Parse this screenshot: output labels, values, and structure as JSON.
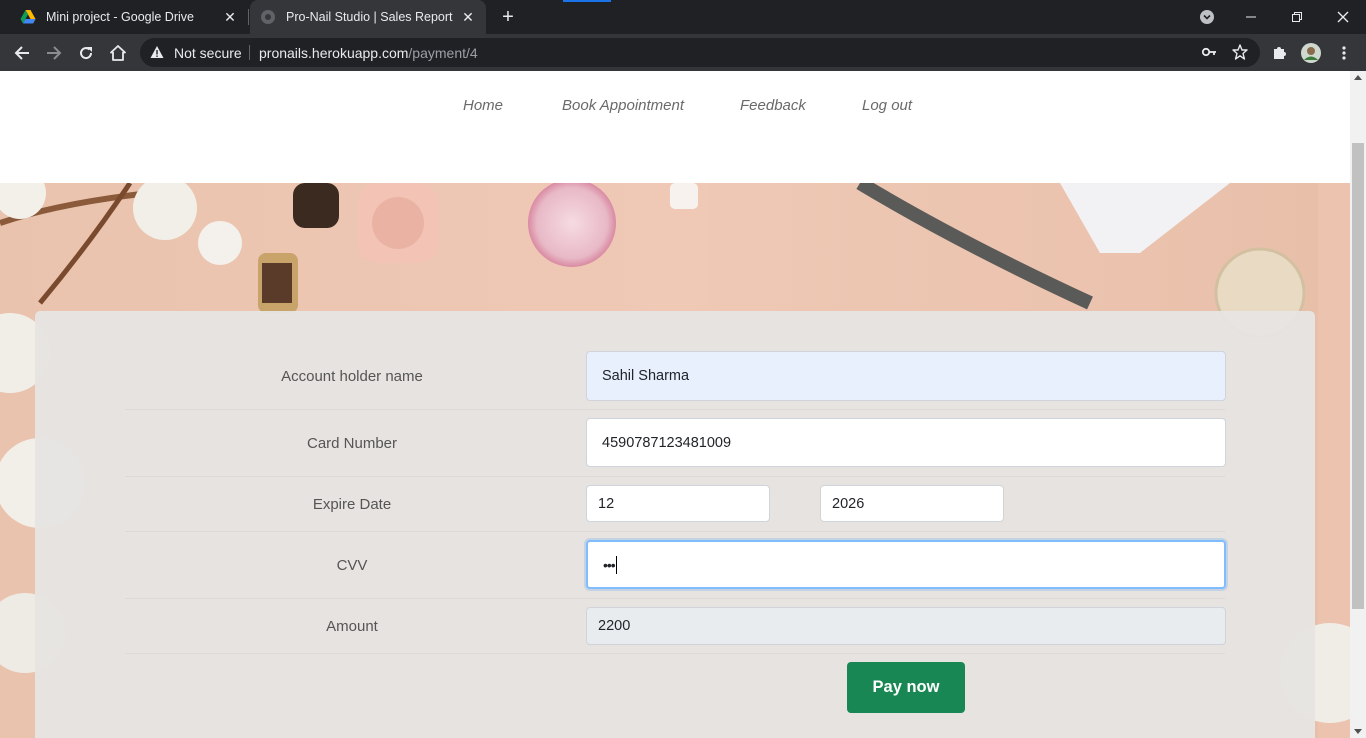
{
  "browser": {
    "tabs": [
      {
        "title": "Mini project - Google Drive",
        "icon": "google-drive-icon"
      },
      {
        "title": "Pro-Nail Studio | Sales Report",
        "icon": "globe-icon",
        "active": true
      }
    ],
    "address": {
      "security_label": "Not secure",
      "host": "pronails.herokuapp.com",
      "path": "/payment/4"
    }
  },
  "nav": {
    "items": [
      "Home",
      "Book Appointment",
      "Feedback",
      "Log out"
    ]
  },
  "form": {
    "account_holder": {
      "label": "Account holder name",
      "value": "Sahil Sharma"
    },
    "card_number": {
      "label": "Card Number",
      "value": "4590787123481009"
    },
    "expire": {
      "label": "Expire Date",
      "month": "12",
      "year": "2026"
    },
    "cvv": {
      "label": "CVV",
      "value": "•••"
    },
    "amount": {
      "label": "Amount",
      "value": "2200"
    },
    "submit_label": "Pay now"
  },
  "colors": {
    "button": "#198754",
    "chrome_dark": "#202124",
    "chrome_toolbar": "#35363a",
    "focus_border": "#80bdff",
    "autofill_bg": "#e8f0fe"
  }
}
